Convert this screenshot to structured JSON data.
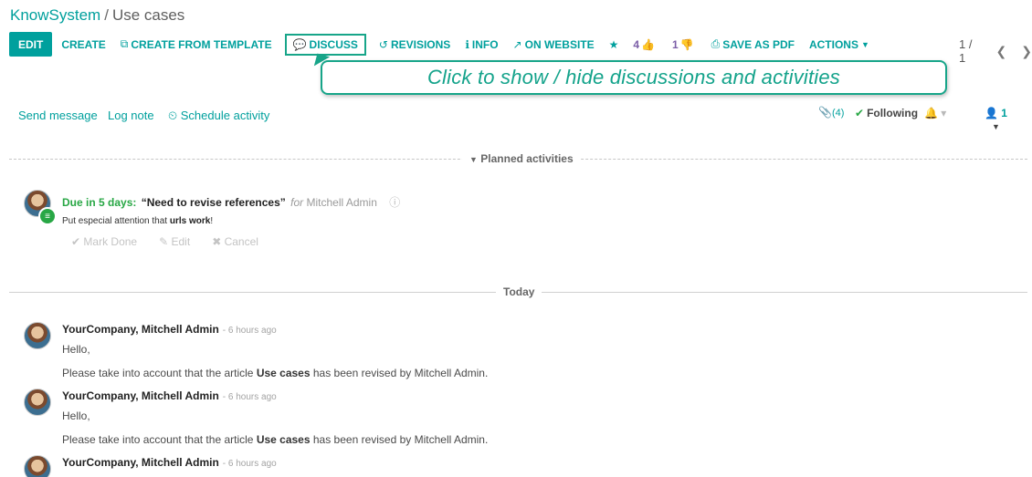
{
  "breadcrumb": {
    "parent": "KnowSystem",
    "separator": "/",
    "current": "Use cases"
  },
  "toolbar": {
    "edit": "EDIT",
    "create": "CREATE",
    "create_from_template": "CREATE FROM TEMPLATE",
    "discuss": "DISCUSS",
    "revisions": "REVISIONS",
    "info": "INFO",
    "on_website": "ON WEBSITE",
    "likes": "4",
    "dislikes": "1",
    "save_as_pdf": "SAVE AS PDF",
    "actions": "ACTIONS"
  },
  "pager": {
    "value": "1 / 1"
  },
  "callout": {
    "text": "Click to show / hide discussions and activities"
  },
  "chatter": {
    "send_message": "Send message",
    "log_note": "Log note",
    "schedule_activity": "Schedule activity",
    "attachments_count": "(4)",
    "following": "Following",
    "followers_count": "1"
  },
  "planned": {
    "label": "Planned activities",
    "due": "Due in 5 days:",
    "summary": "“Need to revise references”",
    "for": "for",
    "assignee": "Mitchell Admin",
    "note_prefix": "Put especial attention that",
    "note_bold": "urls work",
    "note_suffix": "!",
    "mark_done": "Mark Done",
    "edit": "Edit",
    "cancel": "Cancel"
  },
  "today_label": "Today",
  "messages": [
    {
      "author": "YourCompany, Mitchell Admin",
      "time": "- 6 hours ago",
      "greeting": "Hello,",
      "body_prefix": "Please take into account that the article",
      "body_bold": "Use cases",
      "body_suffix": "has been revised by Mitchell Admin."
    },
    {
      "author": "YourCompany, Mitchell Admin",
      "time": "- 6 hours ago",
      "greeting": "Hello,",
      "body_prefix": "Please take into account that the article",
      "body_bold": "Use cases",
      "body_suffix": "has been revised by Mitchell Admin."
    },
    {
      "author": "YourCompany, Mitchell Admin",
      "time": "- 6 hours ago"
    }
  ],
  "colors": {
    "accent": "#00a09d",
    "callout_border": "#17a589",
    "success": "#28a745",
    "rating": "#7b5ea7"
  }
}
